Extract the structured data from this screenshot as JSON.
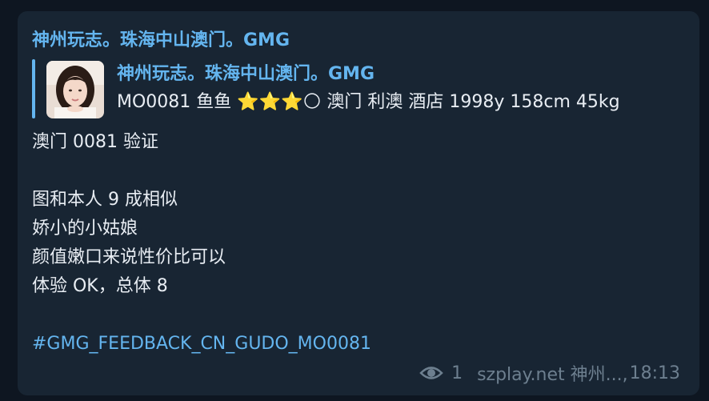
{
  "message": {
    "sender": "神州玩志。珠海中山澳门。GMG",
    "reply": {
      "title": "神州玩志。珠海中山澳门。GMG",
      "snippet": "MO0081 鱼鱼 ⭐⭐⭐🌕 澳门 利澳 酒店 1998y  158cm 45kg"
    },
    "body_lines": [
      "澳门 0081 验证",
      "",
      "图和本人 9 成相似",
      "娇小的小姑娘",
      "颜值嫩口来说性价比可以",
      "体验 OK，总体 8"
    ],
    "hashtag": "#GMG_FEEDBACK_CN_GUDO_MO0081",
    "views": "1",
    "author": "szplay.net 神州...,",
    "time": "18:13"
  },
  "colors": {
    "background": "#0e1621",
    "bubble": "#182533",
    "accent": "#64b5ef",
    "text": "#e8edf3",
    "meta": "#6d7f8f"
  },
  "icons": {
    "views": "eye-icon"
  }
}
